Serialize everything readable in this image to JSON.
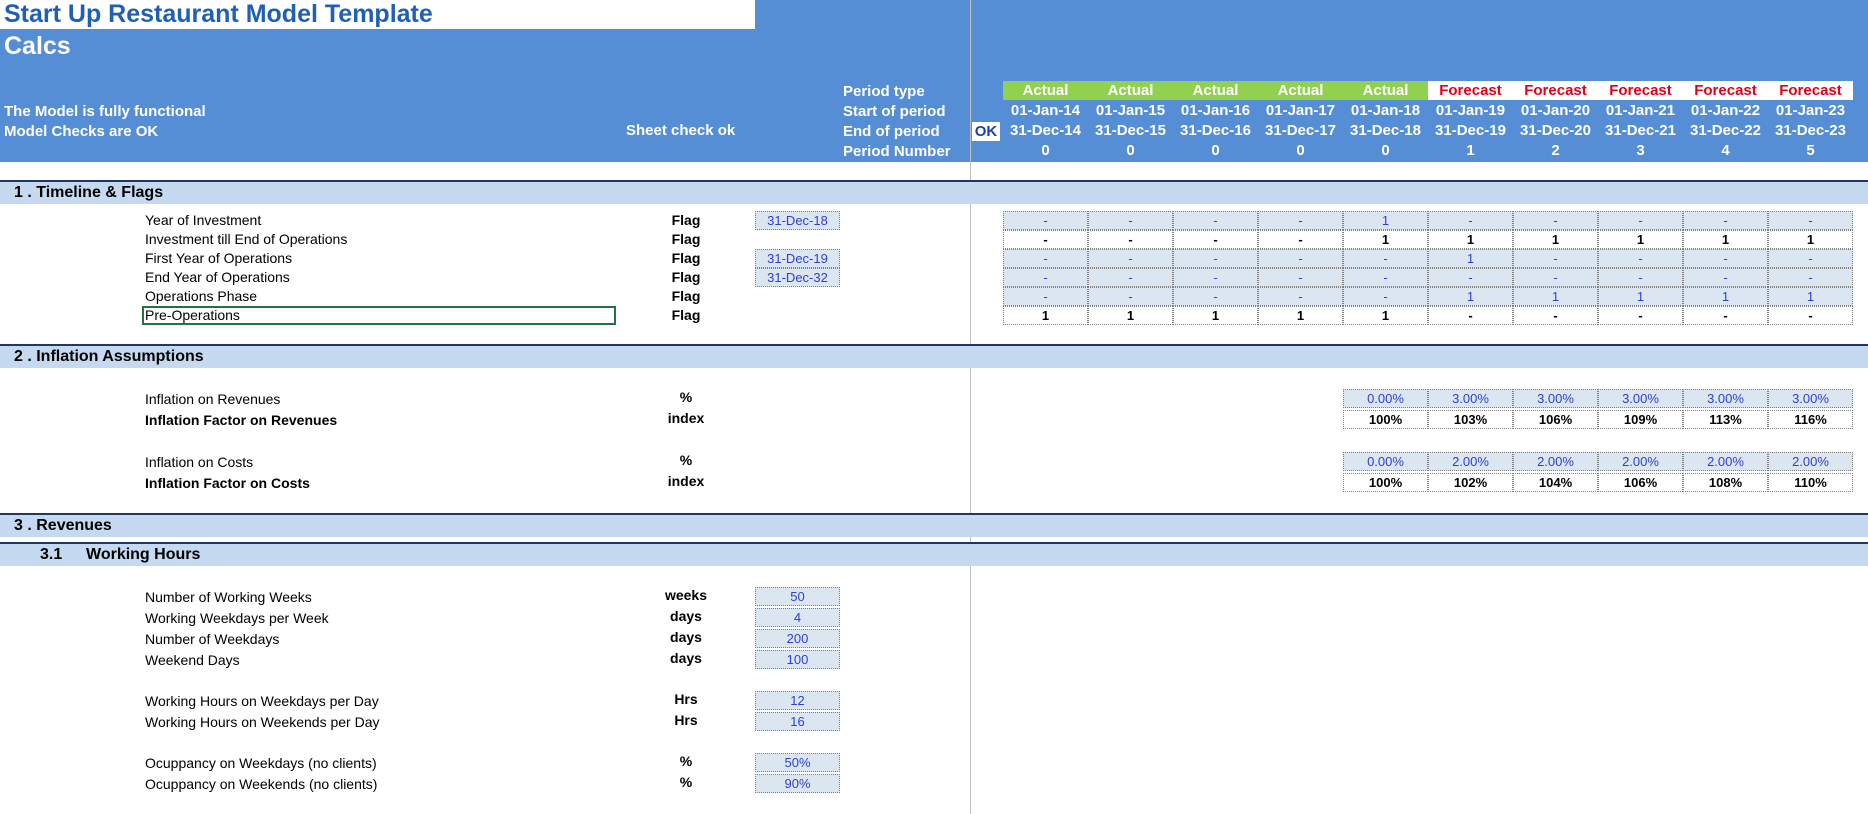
{
  "title": "Start Up Restaurant Model Template",
  "sheet": "Calcs",
  "status": {
    "functional": "The Model is fully functional",
    "checks": "Model Checks are OK",
    "sheet_check": "Sheet check ok",
    "ok_badge": "OK"
  },
  "row_labels": {
    "period_type": "Period type",
    "start": "Start of period",
    "end": "End of period",
    "number": "Period Number"
  },
  "periods": [
    {
      "type": "Actual",
      "start": "01-Jan-14",
      "end": "31-Dec-14",
      "num": "0"
    },
    {
      "type": "Actual",
      "start": "01-Jan-15",
      "end": "31-Dec-15",
      "num": "0"
    },
    {
      "type": "Actual",
      "start": "01-Jan-16",
      "end": "31-Dec-16",
      "num": "0"
    },
    {
      "type": "Actual",
      "start": "01-Jan-17",
      "end": "31-Dec-17",
      "num": "0"
    },
    {
      "type": "Actual",
      "start": "01-Jan-18",
      "end": "31-Dec-18",
      "num": "0"
    },
    {
      "type": "Forecast",
      "start": "01-Jan-19",
      "end": "31-Dec-19",
      "num": "1"
    },
    {
      "type": "Forecast",
      "start": "01-Jan-20",
      "end": "31-Dec-20",
      "num": "2"
    },
    {
      "type": "Forecast",
      "start": "01-Jan-21",
      "end": "31-Dec-21",
      "num": "3"
    },
    {
      "type": "Forecast",
      "start": "01-Jan-22",
      "end": "31-Dec-22",
      "num": "4"
    },
    {
      "type": "Forecast",
      "start": "01-Jan-23",
      "end": "31-Dec-23",
      "num": "5"
    }
  ],
  "colors": {
    "header_blue": "#558ed5",
    "section_band": "#c5d9f1",
    "actual_green": "#92d050",
    "forecast_red": "#e0001b",
    "input_fill": "#dce6f1",
    "input_text": "#2b3fd6"
  },
  "sections": {
    "s1": "1 .  Timeline & Flags",
    "s2": "2 .  Inflation Assumptions",
    "s3": "3 .  Revenues",
    "s31_num": "3.1",
    "s31_title": "Working Hours"
  },
  "flags": [
    {
      "label": "Year of Investment",
      "unit": "Flag",
      "date": "31-Dec-18",
      "vals": [
        "-",
        "-",
        "-",
        "-",
        "1",
        "-",
        "-",
        "-",
        "-",
        "-"
      ],
      "style": "in"
    },
    {
      "label": "Investment till End of Operations",
      "unit": "Flag",
      "date": "",
      "vals": [
        "-",
        "-",
        "-",
        "-",
        "1",
        "1",
        "1",
        "1",
        "1",
        "1"
      ],
      "style": "calc"
    },
    {
      "label": "First Year of Operations",
      "unit": "Flag",
      "date": "31-Dec-19",
      "vals": [
        "-",
        "-",
        "-",
        "-",
        "-",
        "1",
        "-",
        "-",
        "-",
        "-"
      ],
      "style": "in"
    },
    {
      "label": "End Year of Operations",
      "unit": "Flag",
      "date": "31-Dec-32",
      "vals": [
        "-",
        "-",
        "-",
        "-",
        "-",
        "-",
        "-",
        "-",
        "-",
        "-"
      ],
      "style": "in"
    },
    {
      "label": "Operations Phase",
      "unit": "Flag",
      "date": "",
      "vals": [
        "-",
        "-",
        "-",
        "-",
        "-",
        "1",
        "1",
        "1",
        "1",
        "1"
      ],
      "style": "in"
    },
    {
      "label": "Pre-Operations",
      "unit": "Flag",
      "date": "",
      "vals": [
        "1",
        "1",
        "1",
        "1",
        "1",
        "-",
        "-",
        "-",
        "-",
        "-"
      ],
      "style": "calc"
    }
  ],
  "inflation": [
    {
      "label": "Inflation on Revenues",
      "unit": "%",
      "bold": false,
      "vals": [
        "0.00%",
        "3.00%",
        "3.00%",
        "3.00%",
        "3.00%",
        "3.00%"
      ],
      "style": "in"
    },
    {
      "label": "Inflation Factor on Revenues",
      "unit": "index",
      "bold": true,
      "vals": [
        "100%",
        "103%",
        "106%",
        "109%",
        "113%",
        "116%"
      ],
      "style": "calc"
    },
    {
      "label": "Inflation on Costs",
      "unit": "%",
      "bold": false,
      "vals": [
        "0.00%",
        "2.00%",
        "2.00%",
        "2.00%",
        "2.00%",
        "2.00%"
      ],
      "style": "in"
    },
    {
      "label": "Inflation Factor on Costs",
      "unit": "index",
      "bold": true,
      "vals": [
        "100%",
        "102%",
        "104%",
        "106%",
        "108%",
        "110%"
      ],
      "style": "calc"
    }
  ],
  "hours": [
    {
      "label": "Number of Working Weeks",
      "unit": "weeks",
      "value": "50"
    },
    {
      "label": "Working Weekdays per Week",
      "unit": "days",
      "value": "4"
    },
    {
      "label": "Number of Weekdays",
      "unit": "days",
      "value": "200"
    },
    {
      "label": "Weekend Days",
      "unit": "days",
      "value": "100"
    },
    {
      "label": "Working Hours on Weekdays per Day",
      "unit": "Hrs",
      "value": "12"
    },
    {
      "label": "Working Hours on Weekends per Day",
      "unit": "Hrs",
      "value": "16"
    },
    {
      "label": "Ocuppancy on Weekdays (no clients)",
      "unit": "%",
      "value": "50%"
    },
    {
      "label": "Ocuppancy on Weekends (no clients)",
      "unit": "%",
      "value": "90%"
    }
  ]
}
